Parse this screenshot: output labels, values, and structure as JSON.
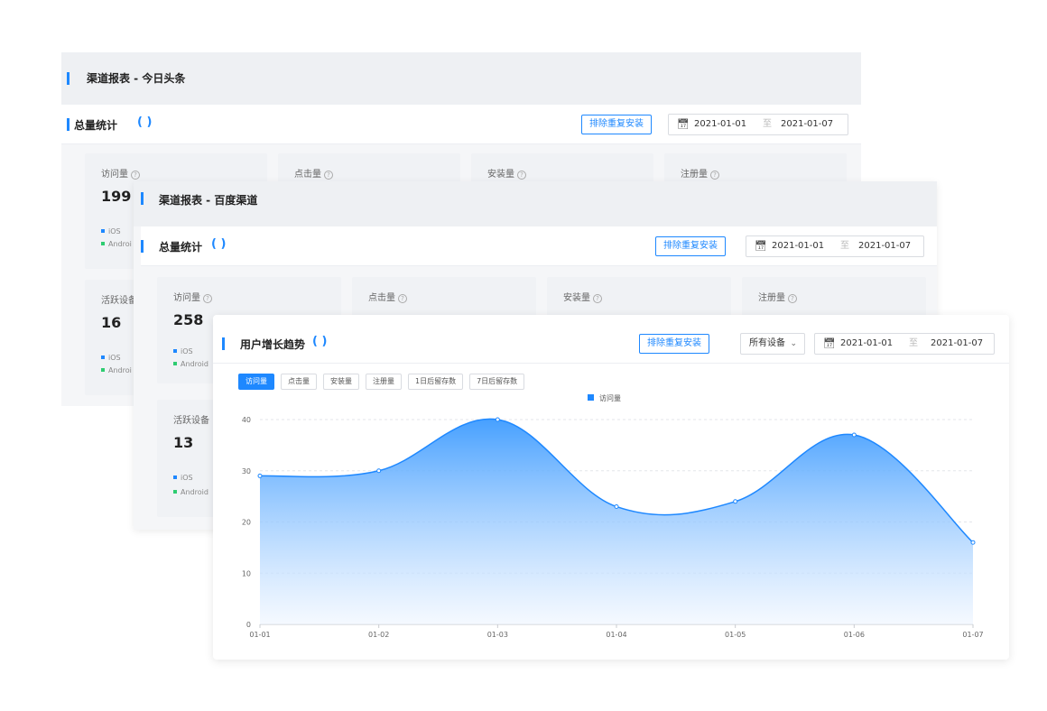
{
  "panel_toutiao": {
    "title": "渠道报表 - 今日头条",
    "stat_title": "总量统计",
    "spinner": "( )",
    "dedup_label": "排除重复安装",
    "date_start": "2021-01-01",
    "date_sep": "至",
    "date_end": "2021-01-07",
    "cards": [
      {
        "label": "访问量",
        "value": "199",
        "legend": [
          "iOS",
          "Androi"
        ]
      },
      {
        "label": "点击量"
      },
      {
        "label": "安装量"
      },
      {
        "label": "注册量"
      },
      {
        "label": "活跃设备",
        "value": "16",
        "legend": [
          "iOS",
          "Androi"
        ]
      }
    ]
  },
  "panel_baidu": {
    "title": "渠道报表 - 百度渠道",
    "stat_title": "总量统计",
    "spinner": "( )",
    "dedup_label": "排除重复安装",
    "date_start": "2021-01-01",
    "date_sep": "至",
    "date_end": "2021-01-07",
    "cards": [
      {
        "label": "访问量",
        "value": "258",
        "legend": [
          "iOS",
          "Android"
        ]
      },
      {
        "label": "点击量"
      },
      {
        "label": "安装量"
      },
      {
        "label": "注册量"
      },
      {
        "label": "活跃设备",
        "value": "13",
        "legend": [
          "iOS",
          "Android"
        ]
      }
    ]
  },
  "trend": {
    "title": "用户增长趋势",
    "spinner": "( )",
    "dedup_label": "排除重复安装",
    "device_select": "所有设备",
    "date_start": "2021-01-01",
    "date_sep": "至",
    "date_end": "2021-01-07",
    "tabs": [
      "访问量",
      "点击量",
      "安装量",
      "注册量",
      "1日后留存数",
      "7日后留存数"
    ],
    "active_tab": 0
  },
  "colors": {
    "accent": "#1e88ff",
    "ios": "#1e88ff",
    "android": "#2ecc71",
    "area_top": "#3d9bff",
    "area_bottom": "#eef5ff"
  },
  "chart_data": {
    "type": "area",
    "x": [
      "01-01",
      "01-02",
      "01-03",
      "01-04",
      "01-05",
      "01-06",
      "01-07"
    ],
    "series": [
      {
        "name": "访问量",
        "values": [
          29,
          30,
          40,
          23,
          24,
          37,
          16
        ]
      }
    ],
    "ylim": [
      0,
      40
    ],
    "yticks": [
      0,
      10,
      20,
      30,
      40
    ],
    "smooth": true,
    "grid": "horizontal-dashed",
    "legend": "top-center"
  }
}
